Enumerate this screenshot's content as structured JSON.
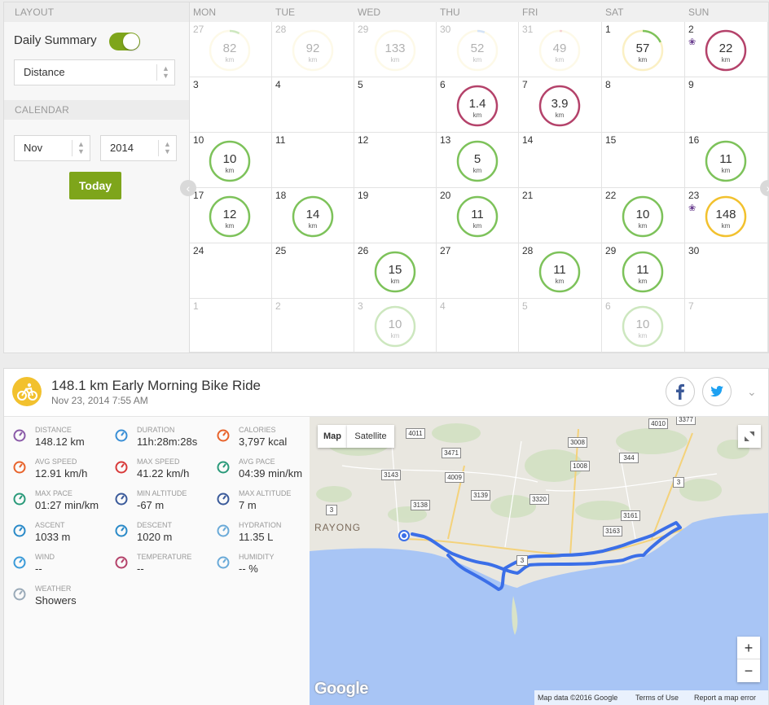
{
  "layout": {
    "section_label": "LAYOUT",
    "daily_summary_label": "Daily Summary",
    "metric_select": "Distance"
  },
  "calendar_section": {
    "section_label": "CALENDAR",
    "month_select": "Nov",
    "year_select": "2014",
    "today_button": "Today"
  },
  "calendar": {
    "weekdays": [
      "MON",
      "TUE",
      "WED",
      "THU",
      "FRI",
      "SAT",
      "SUN"
    ],
    "unit": "km",
    "ring_colors": {
      "green": "#7dc25a",
      "red": "#b4426a",
      "yellow": "#f2c12e"
    },
    "weeks": [
      [
        {
          "day": "27",
          "other": true,
          "value": "82",
          "color": "yellow",
          "progress": 0.08
        },
        {
          "day": "28",
          "other": true,
          "value": "92",
          "color": "yellow",
          "progress": 0
        },
        {
          "day": "29",
          "other": true,
          "value": "133",
          "color": "yellow",
          "progress": 0
        },
        {
          "day": "30",
          "other": true,
          "value": "52",
          "color": "yellow",
          "progress": 0.06
        },
        {
          "day": "31",
          "other": true,
          "value": "49",
          "color": "yellow",
          "progress": 0.02
        },
        {
          "day": "1",
          "other": false,
          "value": "57",
          "color": "yellow",
          "progress": 0.18
        },
        {
          "day": "2",
          "other": false,
          "value": "22",
          "color": "red",
          "progress": 1,
          "trophy": true
        }
      ],
      [
        {
          "day": "3",
          "other": false
        },
        {
          "day": "4",
          "other": false
        },
        {
          "day": "5",
          "other": false
        },
        {
          "day": "6",
          "other": false,
          "value": "1.4",
          "color": "red",
          "progress": 1
        },
        {
          "day": "7",
          "other": false,
          "value": "3.9",
          "color": "red",
          "progress": 1
        },
        {
          "day": "8",
          "other": false
        },
        {
          "day": "9",
          "other": false
        }
      ],
      [
        {
          "day": "10",
          "other": false,
          "value": "10",
          "color": "green",
          "progress": 1
        },
        {
          "day": "11",
          "other": false
        },
        {
          "day": "12",
          "other": false
        },
        {
          "day": "13",
          "other": false,
          "value": "5",
          "color": "green",
          "progress": 1
        },
        {
          "day": "14",
          "other": false
        },
        {
          "day": "15",
          "other": false
        },
        {
          "day": "16",
          "other": false,
          "value": "11",
          "color": "green",
          "progress": 1
        }
      ],
      [
        {
          "day": "17",
          "other": false,
          "value": "12",
          "color": "green",
          "progress": 1
        },
        {
          "day": "18",
          "other": false,
          "value": "14",
          "color": "green",
          "progress": 1
        },
        {
          "day": "19",
          "other": false
        },
        {
          "day": "20",
          "other": false,
          "value": "11",
          "color": "green",
          "progress": 1
        },
        {
          "day": "21",
          "other": false
        },
        {
          "day": "22",
          "other": false,
          "value": "10",
          "color": "green",
          "progress": 1
        },
        {
          "day": "23",
          "other": false,
          "value": "148",
          "color": "yellow",
          "progress": 1,
          "trophy": true
        }
      ],
      [
        {
          "day": "24",
          "other": false
        },
        {
          "day": "25",
          "other": false
        },
        {
          "day": "26",
          "other": false,
          "value": "15",
          "color": "green",
          "progress": 1
        },
        {
          "day": "27",
          "other": false
        },
        {
          "day": "28",
          "other": false,
          "value": "11",
          "color": "green",
          "progress": 1
        },
        {
          "day": "29",
          "other": false,
          "value": "11",
          "color": "green",
          "progress": 1
        },
        {
          "day": "30",
          "other": false
        }
      ],
      [
        {
          "day": "1",
          "other": true
        },
        {
          "day": "2",
          "other": true
        },
        {
          "day": "3",
          "other": true,
          "value": "10",
          "color": "green",
          "progress": 1
        },
        {
          "day": "4",
          "other": true
        },
        {
          "day": "5",
          "other": true
        },
        {
          "day": "6",
          "other": true,
          "value": "10",
          "color": "green",
          "progress": 1
        },
        {
          "day": "7",
          "other": true
        }
      ]
    ]
  },
  "activity": {
    "title": "148.1 km Early Morning Bike Ride",
    "date": "Nov 23, 2014 7:55 AM",
    "stats": [
      {
        "label": "DISTANCE",
        "value": "148.12 km",
        "icon": "distance-icon",
        "color": "#8a5aa8"
      },
      {
        "label": "DURATION",
        "value": "11h:28m:28s",
        "icon": "stopwatch-icon",
        "color": "#3a8fd6"
      },
      {
        "label": "CALORIES",
        "value": "3,797 kcal",
        "icon": "flame-icon",
        "color": "#e8632b"
      },
      {
        "label": "AVG SPEED",
        "value": "12.91 km/h",
        "icon": "speedometer-icon",
        "color": "#e8632b"
      },
      {
        "label": "MAX SPEED",
        "value": "41.22 km/h",
        "icon": "speedometer-icon",
        "color": "#d83a3a"
      },
      {
        "label": "AVG PACE",
        "value": "04:39 min/km",
        "icon": "pace-gauge-icon",
        "color": "#2a9a7a"
      },
      {
        "label": "MAX PACE",
        "value": "01:27 min/km",
        "icon": "pace-gauge-icon",
        "color": "#2a9a7a"
      },
      {
        "label": "MIN ALTITUDE",
        "value": "-67 m",
        "icon": "mountain-low-icon",
        "color": "#3a5a9a"
      },
      {
        "label": "MAX ALTITUDE",
        "value": "7 m",
        "icon": "mountain-high-icon",
        "color": "#3a5a9a"
      },
      {
        "label": "ASCENT",
        "value": "1033 m",
        "icon": "ascent-icon",
        "color": "#2a8ac8"
      },
      {
        "label": "DESCENT",
        "value": "1020 m",
        "icon": "descent-icon",
        "color": "#2a8ac8"
      },
      {
        "label": "HYDRATION",
        "value": "11.35 L",
        "icon": "water-drops-icon",
        "color": "#6aaad8"
      },
      {
        "label": "WIND",
        "value": "--",
        "icon": "wind-icon",
        "color": "#3a9ad8"
      },
      {
        "label": "TEMPERATURE",
        "value": "--",
        "icon": "thermometer-icon",
        "color": "#b4426a"
      },
      {
        "label": "HUMIDITY",
        "value": "-- %",
        "icon": "humidity-icon",
        "color": "#6aaad8"
      },
      {
        "label": "WEATHER",
        "value": "Showers",
        "icon": "showers-cloud-icon",
        "color": "#9aaab8"
      }
    ]
  },
  "map": {
    "type_map": "Map",
    "type_satellite": "Satellite",
    "city_label": "RAYONG",
    "zoom_in": "+",
    "zoom_out": "−",
    "logo": "Google",
    "attribution": "Map data ©2016 Google",
    "terms": "Terms of Use",
    "report": "Report a map error",
    "route_color": "#3b6fe8",
    "road_shields": [
      "4011",
      "3471",
      "3143",
      "4009",
      "3138",
      "3139",
      "3320",
      "3008",
      "1008",
      "344",
      "4010",
      "3377",
      "3",
      "3161",
      "3163",
      "3",
      "3"
    ]
  }
}
